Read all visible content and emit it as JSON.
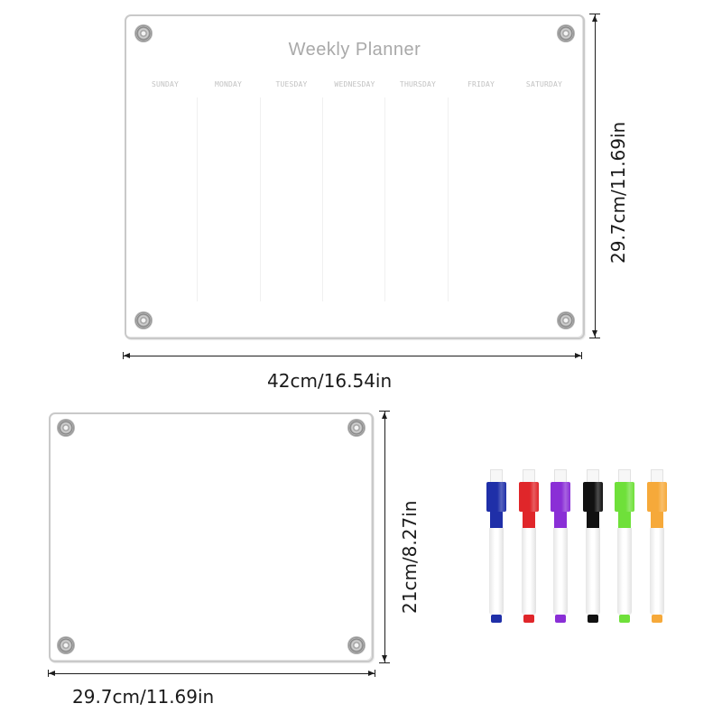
{
  "large_board": {
    "title": "Weekly Planner",
    "days": [
      "SUNDAY",
      "MONDAY",
      "TUESDAY",
      "WEDNESDAY",
      "THURSDAY",
      "FRIDAY",
      "SATURDAY"
    ],
    "width_label": "42cm/16.54in",
    "height_label": "29.7cm/11.69in"
  },
  "small_board": {
    "width_label": "29.7cm/11.69in",
    "height_label": "21cm/8.27in"
  },
  "markers": [
    {
      "name": "blue",
      "color": "#1f2fa8"
    },
    {
      "name": "red",
      "color": "#e0262a"
    },
    {
      "name": "purple",
      "color": "#8a2fd6"
    },
    {
      "name": "black",
      "color": "#111111"
    },
    {
      "name": "green",
      "color": "#6fe03a"
    },
    {
      "name": "orange",
      "color": "#f6a93a"
    }
  ]
}
